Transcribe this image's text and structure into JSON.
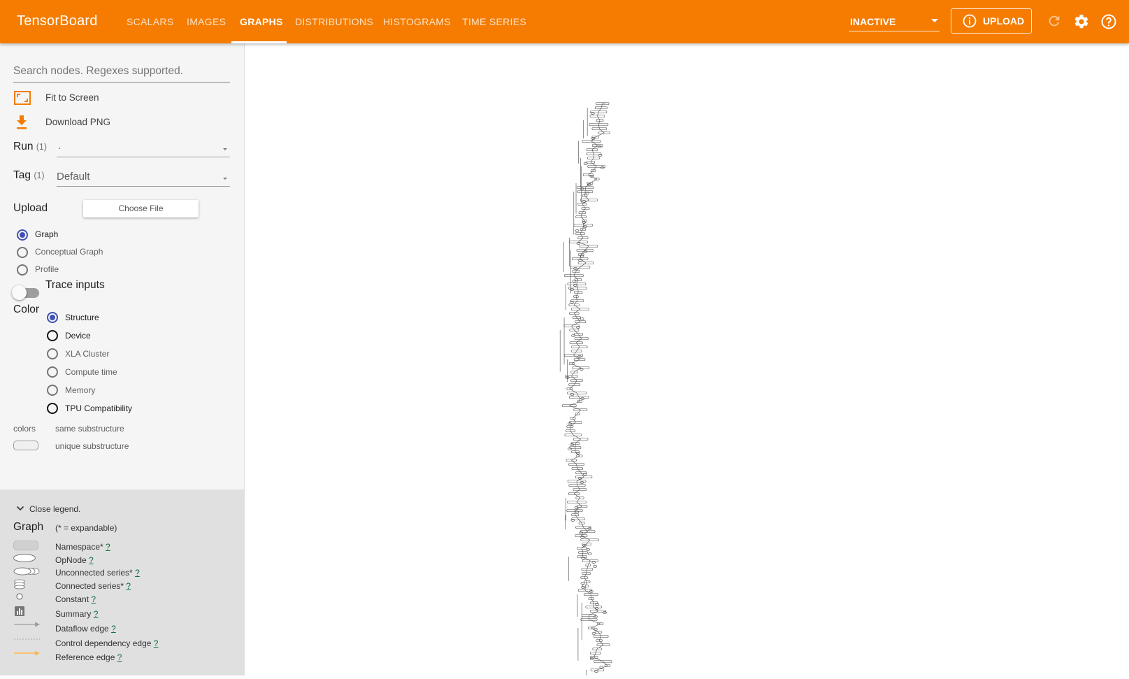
{
  "header": {
    "brand": "TensorBoard",
    "tabs": [
      "SCALARS",
      "IMAGES",
      "GRAPHS",
      "DISTRIBUTIONS",
      "HISTOGRAMS",
      "TIME SERIES"
    ],
    "active_tab": "GRAPHS",
    "status_select": "INACTIVE",
    "upload_label": "UPLOAD",
    "icons": [
      "info-icon",
      "refresh-icon",
      "settings-icon",
      "help-icon"
    ]
  },
  "sidebar": {
    "search_placeholder": "Search nodes. Regexes supported.",
    "fit_label": "Fit to Screen",
    "download_label": "Download PNG",
    "run_label": "Run",
    "run_count": "(1)",
    "run_value": ".",
    "tag_label": "Tag",
    "tag_count": "(1)",
    "tag_value": "Default",
    "upload_label": "Upload",
    "choose_file": "Choose File",
    "graph_types": [
      "Graph",
      "Conceptual Graph",
      "Profile"
    ],
    "trace_inputs": "Trace inputs",
    "color_label": "Color",
    "color_options": [
      "Structure",
      "Device",
      "XLA Cluster",
      "Compute time",
      "Memory",
      "TPU Compatibility"
    ],
    "colors_label": "colors",
    "same_substructure": "same substructure",
    "unique_substructure": "unique substructure"
  },
  "legend": {
    "close_label": "Close legend.",
    "graph_label": "Graph",
    "expandable_note": "(* = expandable)",
    "help_mark": "?",
    "items": [
      "Namespace*",
      "OpNode",
      "Unconnected series*",
      "Connected series*",
      "Constant",
      "Summary",
      "Dataflow edge",
      "Control dependency edge",
      "Reference edge"
    ]
  },
  "colors": {
    "brand": "#f57c00",
    "accent": "#3f51b5",
    "sidebar_bg": "#f5f5f5",
    "legend_bg": "#e0e0e0"
  }
}
